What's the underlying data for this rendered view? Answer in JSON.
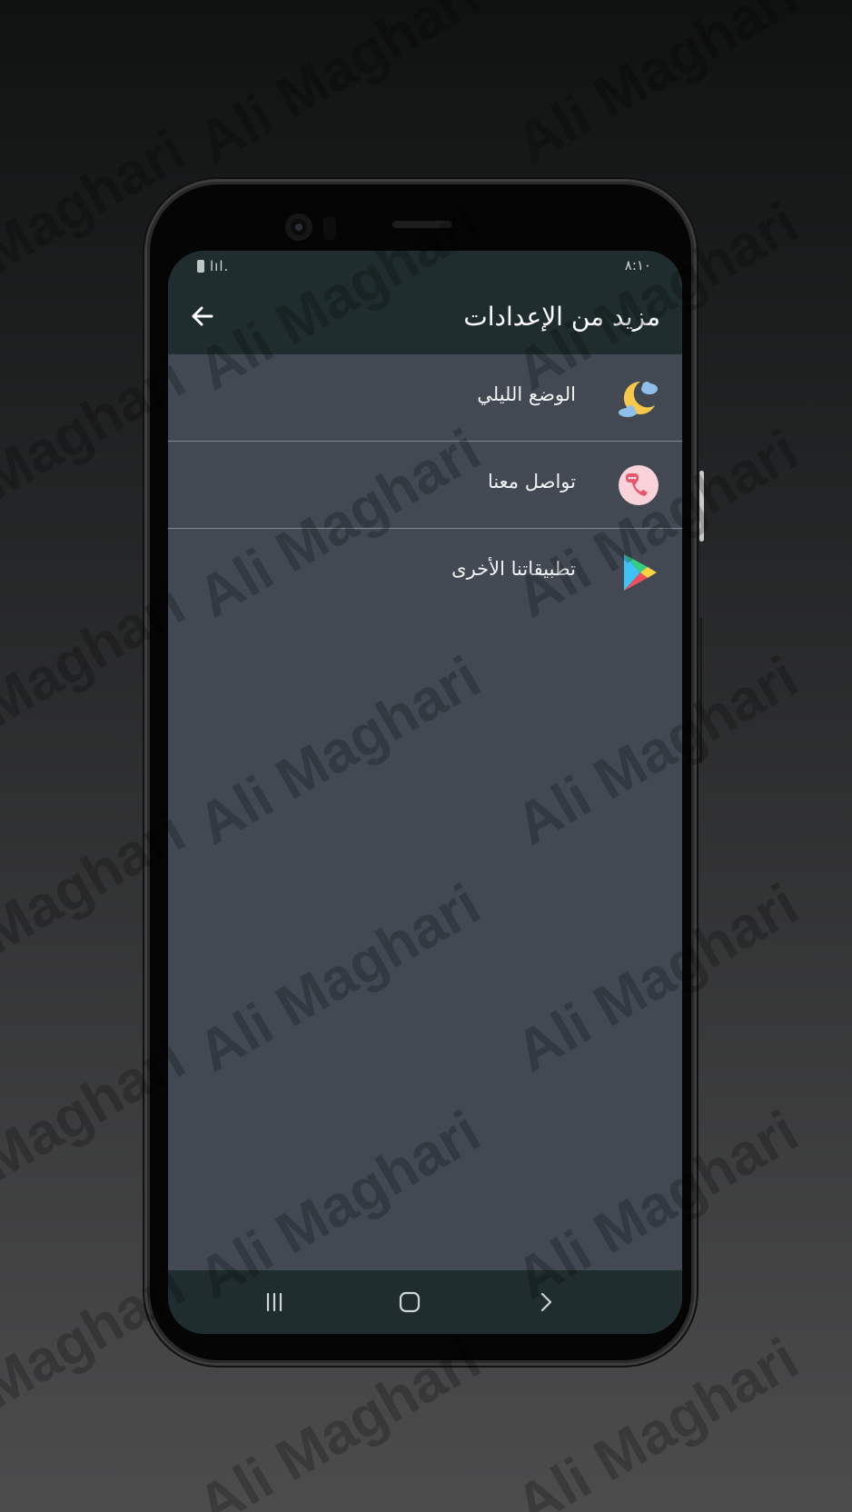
{
  "watermark": {
    "text": "Ali Maghari"
  },
  "status_bar": {
    "time": "٨:١٠",
    "signal": "lıl."
  },
  "app_bar": {
    "title": "مزيد من الإعدادات",
    "back_icon": "arrow-left-icon"
  },
  "settings": {
    "items": [
      {
        "label": "الوضع الليلي",
        "icon": "moon-cloud-icon"
      },
      {
        "label": "تواصل معنا",
        "icon": "phone-chat-icon"
      },
      {
        "label": "تطبيقاتنا الأخرى",
        "icon": "play-store-icon"
      }
    ]
  },
  "nav_bar": {
    "recents_icon": "recents-icon",
    "home_icon": "home-icon",
    "back_icon": "chevron-right-icon"
  },
  "colors": {
    "bar": "#1f2d2e",
    "content": "#424953",
    "divider": "#7f878f",
    "text": "#f2f4f5"
  }
}
